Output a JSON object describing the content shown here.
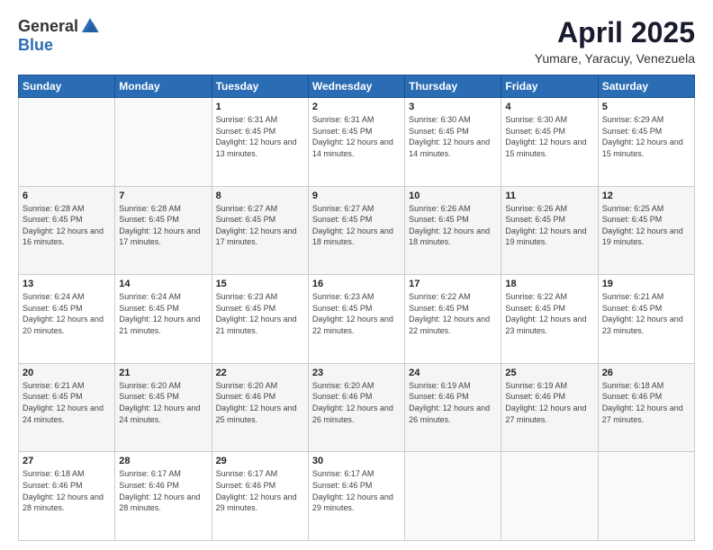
{
  "header": {
    "logo_general": "General",
    "logo_blue": "Blue",
    "month_title": "April 2025",
    "location": "Yumare, Yaracuy, Venezuela"
  },
  "days_of_week": [
    "Sunday",
    "Monday",
    "Tuesday",
    "Wednesday",
    "Thursday",
    "Friday",
    "Saturday"
  ],
  "weeks": [
    [
      {
        "day": "",
        "empty": true
      },
      {
        "day": "",
        "empty": true
      },
      {
        "day": "1",
        "sunrise": "6:31 AM",
        "sunset": "6:45 PM",
        "daylight": "12 hours and 13 minutes."
      },
      {
        "day": "2",
        "sunrise": "6:31 AM",
        "sunset": "6:45 PM",
        "daylight": "12 hours and 14 minutes."
      },
      {
        "day": "3",
        "sunrise": "6:30 AM",
        "sunset": "6:45 PM",
        "daylight": "12 hours and 14 minutes."
      },
      {
        "day": "4",
        "sunrise": "6:30 AM",
        "sunset": "6:45 PM",
        "daylight": "12 hours and 15 minutes."
      },
      {
        "day": "5",
        "sunrise": "6:29 AM",
        "sunset": "6:45 PM",
        "daylight": "12 hours and 15 minutes."
      }
    ],
    [
      {
        "day": "6",
        "sunrise": "6:28 AM",
        "sunset": "6:45 PM",
        "daylight": "12 hours and 16 minutes."
      },
      {
        "day": "7",
        "sunrise": "6:28 AM",
        "sunset": "6:45 PM",
        "daylight": "12 hours and 17 minutes."
      },
      {
        "day": "8",
        "sunrise": "6:27 AM",
        "sunset": "6:45 PM",
        "daylight": "12 hours and 17 minutes."
      },
      {
        "day": "9",
        "sunrise": "6:27 AM",
        "sunset": "6:45 PM",
        "daylight": "12 hours and 18 minutes."
      },
      {
        "day": "10",
        "sunrise": "6:26 AM",
        "sunset": "6:45 PM",
        "daylight": "12 hours and 18 minutes."
      },
      {
        "day": "11",
        "sunrise": "6:26 AM",
        "sunset": "6:45 PM",
        "daylight": "12 hours and 19 minutes."
      },
      {
        "day": "12",
        "sunrise": "6:25 AM",
        "sunset": "6:45 PM",
        "daylight": "12 hours and 19 minutes."
      }
    ],
    [
      {
        "day": "13",
        "sunrise": "6:24 AM",
        "sunset": "6:45 PM",
        "daylight": "12 hours and 20 minutes."
      },
      {
        "day": "14",
        "sunrise": "6:24 AM",
        "sunset": "6:45 PM",
        "daylight": "12 hours and 21 minutes."
      },
      {
        "day": "15",
        "sunrise": "6:23 AM",
        "sunset": "6:45 PM",
        "daylight": "12 hours and 21 minutes."
      },
      {
        "day": "16",
        "sunrise": "6:23 AM",
        "sunset": "6:45 PM",
        "daylight": "12 hours and 22 minutes."
      },
      {
        "day": "17",
        "sunrise": "6:22 AM",
        "sunset": "6:45 PM",
        "daylight": "12 hours and 22 minutes."
      },
      {
        "day": "18",
        "sunrise": "6:22 AM",
        "sunset": "6:45 PM",
        "daylight": "12 hours and 23 minutes."
      },
      {
        "day": "19",
        "sunrise": "6:21 AM",
        "sunset": "6:45 PM",
        "daylight": "12 hours and 23 minutes."
      }
    ],
    [
      {
        "day": "20",
        "sunrise": "6:21 AM",
        "sunset": "6:45 PM",
        "daylight": "12 hours and 24 minutes."
      },
      {
        "day": "21",
        "sunrise": "6:20 AM",
        "sunset": "6:45 PM",
        "daylight": "12 hours and 24 minutes."
      },
      {
        "day": "22",
        "sunrise": "6:20 AM",
        "sunset": "6:46 PM",
        "daylight": "12 hours and 25 minutes."
      },
      {
        "day": "23",
        "sunrise": "6:20 AM",
        "sunset": "6:46 PM",
        "daylight": "12 hours and 26 minutes."
      },
      {
        "day": "24",
        "sunrise": "6:19 AM",
        "sunset": "6:46 PM",
        "daylight": "12 hours and 26 minutes."
      },
      {
        "day": "25",
        "sunrise": "6:19 AM",
        "sunset": "6:46 PM",
        "daylight": "12 hours and 27 minutes."
      },
      {
        "day": "26",
        "sunrise": "6:18 AM",
        "sunset": "6:46 PM",
        "daylight": "12 hours and 27 minutes."
      }
    ],
    [
      {
        "day": "27",
        "sunrise": "6:18 AM",
        "sunset": "6:46 PM",
        "daylight": "12 hours and 28 minutes."
      },
      {
        "day": "28",
        "sunrise": "6:17 AM",
        "sunset": "6:46 PM",
        "daylight": "12 hours and 28 minutes."
      },
      {
        "day": "29",
        "sunrise": "6:17 AM",
        "sunset": "6:46 PM",
        "daylight": "12 hours and 29 minutes."
      },
      {
        "day": "30",
        "sunrise": "6:17 AM",
        "sunset": "6:46 PM",
        "daylight": "12 hours and 29 minutes."
      },
      {
        "day": "",
        "empty": true
      },
      {
        "day": "",
        "empty": true
      },
      {
        "day": "",
        "empty": true
      }
    ]
  ]
}
